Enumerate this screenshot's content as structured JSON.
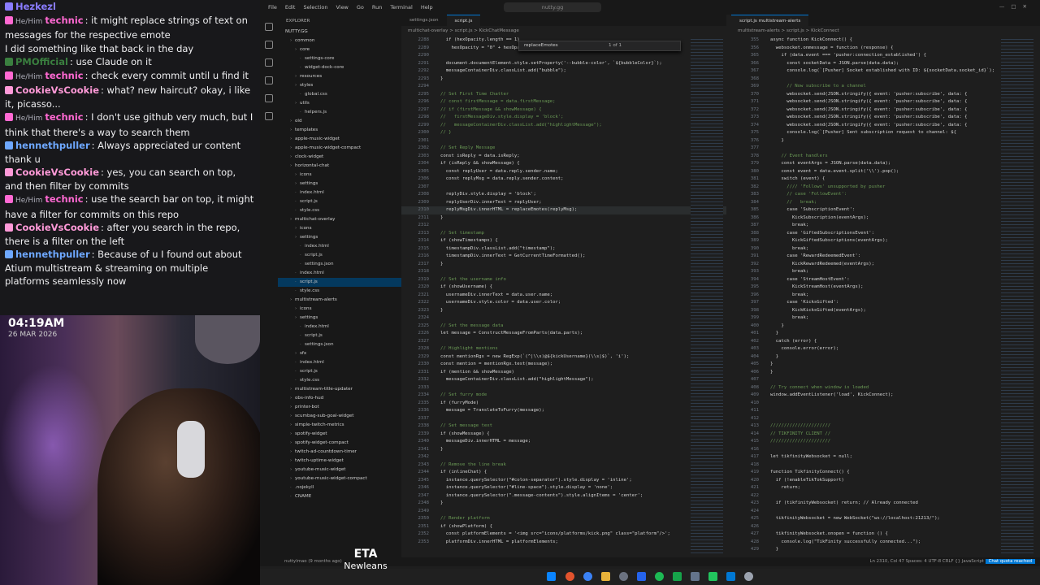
{
  "chat": {
    "messages": [
      {
        "user": "Hezkezl",
        "pronoun": "",
        "text": "",
        "color": "#8a7cff"
      },
      {
        "user": "technic",
        "pronoun": "He/Him",
        "text": ": it might replace strings of text on messages for the respective emote",
        "color": "#ff69d2"
      },
      {
        "user": "",
        "pronoun": "",
        "text": "I did something like that back in the day",
        "color": "#efeff1"
      },
      {
        "user": "PMOfficial",
        "pronoun": "",
        "text": ": use Claude on it",
        "color": "#3a7f3f"
      },
      {
        "user": "technic",
        "pronoun": "He/Him",
        "text": ": check every commit until u find it",
        "color": "#ff69d2"
      },
      {
        "user": "CookieVsCookie",
        "pronoun": "",
        "text": ": what? new haircut? okay, i like it, picasso...",
        "color": "#ff9ad8"
      },
      {
        "user": "technic",
        "pronoun": "He/Him",
        "text": ": I don't use github very much, but I think that there's a way to search them",
        "color": "#ff69d2"
      },
      {
        "user": "hennethpuller",
        "pronoun": "",
        "text": ": Always appreciated ur content thank u",
        "color": "#6ea8ff"
      },
      {
        "user": "CookieVsCookie",
        "pronoun": "",
        "text": ": yes, you can search on top, and then filter by commits",
        "color": "#ff9ad8"
      },
      {
        "user": "technic",
        "pronoun": "He/Him",
        "text": ": use the search bar on top, it might have a filter for commits on this repo",
        "color": "#ff69d2"
      },
      {
        "user": "CookieVsCookie",
        "pronoun": "",
        "text": ": after you search in the repo, there is a filter on the left",
        "color": "#ff9ad8"
      },
      {
        "user": "hennethpuller",
        "pronoun": "",
        "text": ": Because of u I found out about Atium multistream & streaming on multiple platforms seamlessly now",
        "color": "#6ea8ff"
      }
    ],
    "time": "04:19AM",
    "date": "26 MAR 2026"
  },
  "now_playing": {
    "song": "ETA",
    "artist": "NewJeans"
  },
  "vscode": {
    "menu": [
      "File",
      "Edit",
      "Selection",
      "View",
      "Go",
      "Run",
      "Terminal",
      "Help"
    ],
    "search": "nutty.gg",
    "explorer_title": "EXPLORER",
    "root": "NUTTY.GG",
    "tree": [
      {
        "name": "common",
        "depth": 1,
        "folder": true
      },
      {
        "name": "core",
        "depth": 2,
        "folder": true
      },
      {
        "name": "settings-core",
        "depth": 3,
        "folder": false
      },
      {
        "name": "widget-dock-core",
        "depth": 3,
        "folder": false
      },
      {
        "name": "resources",
        "depth": 2,
        "folder": true
      },
      {
        "name": "styles",
        "depth": 2,
        "folder": true
      },
      {
        "name": "global.css",
        "depth": 3,
        "folder": false
      },
      {
        "name": "utils",
        "depth": 2,
        "folder": true
      },
      {
        "name": "helpers.js",
        "depth": 3,
        "folder": false
      },
      {
        "name": "old",
        "depth": 1,
        "folder": true
      },
      {
        "name": "templates",
        "depth": 1,
        "folder": true
      },
      {
        "name": "apple-music-widget",
        "depth": 1,
        "folder": true
      },
      {
        "name": "apple-music-widget-compact",
        "depth": 1,
        "folder": true
      },
      {
        "name": "clock-widget",
        "depth": 1,
        "folder": true
      },
      {
        "name": "horizontal-chat",
        "depth": 1,
        "folder": true
      },
      {
        "name": "icons",
        "depth": 2,
        "folder": true
      },
      {
        "name": "settings",
        "depth": 2,
        "folder": true
      },
      {
        "name": "index.html",
        "depth": 2,
        "folder": false
      },
      {
        "name": "script.js",
        "depth": 2,
        "folder": false
      },
      {
        "name": "style.css",
        "depth": 2,
        "folder": false
      },
      {
        "name": "multichat-overlay",
        "depth": 1,
        "folder": true
      },
      {
        "name": "icons",
        "depth": 2,
        "folder": true
      },
      {
        "name": "settings",
        "depth": 2,
        "folder": true
      },
      {
        "name": "index.html",
        "depth": 3,
        "folder": false
      },
      {
        "name": "script.js",
        "depth": 3,
        "folder": false
      },
      {
        "name": "settings.json",
        "depth": 3,
        "folder": false
      },
      {
        "name": "index.html",
        "depth": 2,
        "folder": false
      },
      {
        "name": "script.js",
        "depth": 2,
        "folder": false,
        "selected": true
      },
      {
        "name": "style.css",
        "depth": 2,
        "folder": false
      },
      {
        "name": "multistream-alerts",
        "depth": 1,
        "folder": true
      },
      {
        "name": "icons",
        "depth": 2,
        "folder": true
      },
      {
        "name": "settings",
        "depth": 2,
        "folder": true
      },
      {
        "name": "index.html",
        "depth": 3,
        "folder": false
      },
      {
        "name": "script.js",
        "depth": 3,
        "folder": false
      },
      {
        "name": "settings.json",
        "depth": 3,
        "folder": false
      },
      {
        "name": "sfx",
        "depth": 2,
        "folder": true
      },
      {
        "name": "index.html",
        "depth": 2,
        "folder": false
      },
      {
        "name": "script.js",
        "depth": 2,
        "folder": false
      },
      {
        "name": "style.css",
        "depth": 2,
        "folder": false
      },
      {
        "name": "multistream-title-updater",
        "depth": 1,
        "folder": true
      },
      {
        "name": "obs-info-hud",
        "depth": 1,
        "folder": true
      },
      {
        "name": "printer-bot",
        "depth": 1,
        "folder": true
      },
      {
        "name": "scumbag-sub-goal-widget",
        "depth": 1,
        "folder": true
      },
      {
        "name": "simple-twitch-metrics",
        "depth": 1,
        "folder": true
      },
      {
        "name": "spotify-widget",
        "depth": 1,
        "folder": true
      },
      {
        "name": "spotify-widget-compact",
        "depth": 1,
        "folder": true
      },
      {
        "name": "twitch-ad-countdown-timer",
        "depth": 1,
        "folder": true
      },
      {
        "name": "twitch-uptime-widget",
        "depth": 1,
        "folder": true
      },
      {
        "name": "youtube-music-widget",
        "depth": 1,
        "folder": true
      },
      {
        "name": "youtube-music-widget-compact",
        "depth": 1,
        "folder": true
      },
      {
        "name": ".nojekyll",
        "depth": 1,
        "folder": false
      },
      {
        "name": "CNAME",
        "depth": 1,
        "folder": false
      }
    ],
    "left_tabs": [
      "settings.json",
      "script.js"
    ],
    "left_breadcrumb": "multichat-overlay  >  script.js  >  KickChatMessage",
    "find_query": "replaceEmotes",
    "find_count": "1 of 1",
    "left_code": [
      {
        "n": "2288",
        "t": "  if (hexOpacity.length == 1)"
      },
      {
        "n": "2289",
        "t": "    hexOpacity = \"0\" + hexOpacity;"
      },
      {
        "n": "2290",
        "t": ""
      },
      {
        "n": "2291",
        "t": "  document.documentElement.style.setProperty('--bubble-color', `${bubbleColor}`);"
      },
      {
        "n": "2292",
        "t": "  messageContainerDiv.classList.add(\"bubble\");"
      },
      {
        "n": "2293",
        "t": "}"
      },
      {
        "n": "2294",
        "t": ""
      },
      {
        "n": "2295",
        "t": "// Set First Time Chatter"
      },
      {
        "n": "2296",
        "t": "// const firstMessage = data.firstMessage;"
      },
      {
        "n": "2297",
        "t": "// if (firstMessage && showMessage) {"
      },
      {
        "n": "2298",
        "t": "//   firstMessageDiv.style.display = 'block';"
      },
      {
        "n": "2299",
        "t": "//   messageContainerDiv.classList.add(\"highlightMessage\");"
      },
      {
        "n": "2300",
        "t": "// }"
      },
      {
        "n": "2301",
        "t": ""
      },
      {
        "n": "2302",
        "t": "// Set Reply Message"
      },
      {
        "n": "2303",
        "t": "const isReply = data.isReply;"
      },
      {
        "n": "2304",
        "t": "if (isReply && showMessage) {"
      },
      {
        "n": "2305",
        "t": "  const replyUser = data.reply.sender.name;"
      },
      {
        "n": "2306",
        "t": "  const replyMsg = data.reply.sender.content;"
      },
      {
        "n": "2307",
        "t": ""
      },
      {
        "n": "2308",
        "t": "  replyDiv.style.display = 'block';"
      },
      {
        "n": "2309",
        "t": "  replyUserDiv.innerText = replyUser;"
      },
      {
        "n": "2310",
        "t": "  replyMsgDiv.innerHTML = replaceEmotes(replyMsg);"
      },
      {
        "n": "2311",
        "t": "}"
      },
      {
        "n": "2312",
        "t": ""
      },
      {
        "n": "2313",
        "t": "// Set timestamp"
      },
      {
        "n": "2314",
        "t": "if (showTimestamps) {"
      },
      {
        "n": "2315",
        "t": "  timestampDiv.classList.add(\"timestamp\");"
      },
      {
        "n": "2316",
        "t": "  timestampDiv.innerText = GetCurrentTimeFormatted();"
      },
      {
        "n": "2317",
        "t": "}"
      },
      {
        "n": "2318",
        "t": ""
      },
      {
        "n": "2319",
        "t": "// Set the username info"
      },
      {
        "n": "2320",
        "t": "if (showUsername) {"
      },
      {
        "n": "2321",
        "t": "  usernameDiv.innerText = data.user.name;"
      },
      {
        "n": "2322",
        "t": "  usernameDiv.style.color = data.user.color;"
      },
      {
        "n": "2323",
        "t": "}"
      },
      {
        "n": "2324",
        "t": ""
      },
      {
        "n": "2325",
        "t": "// Set the message data"
      },
      {
        "n": "2326",
        "t": "let message = ConstructMessageFromParts(data.parts);"
      },
      {
        "n": "2327",
        "t": ""
      },
      {
        "n": "2328",
        "t": "// Highlight mentions"
      },
      {
        "n": "2329",
        "t": "const mentionRgx = new RegExp(`(^|\\\\s)@${kickUsername}(\\\\s|$)`, 'i');"
      },
      {
        "n": "2330",
        "t": "const mention = mentionRgx.test(message);"
      },
      {
        "n": "2331",
        "t": "if (mention && showMessage)"
      },
      {
        "n": "2332",
        "t": "  messageContainerDiv.classList.add(\"highlightMessage\");"
      },
      {
        "n": "2333",
        "t": ""
      },
      {
        "n": "2334",
        "t": "// Set furry mode"
      },
      {
        "n": "2335",
        "t": "if (furryMode)"
      },
      {
        "n": "2336",
        "t": "  message = TranslateToFurry(message);"
      },
      {
        "n": "2337",
        "t": ""
      },
      {
        "n": "2338",
        "t": "// Set message text"
      },
      {
        "n": "2339",
        "t": "if (showMessage) {"
      },
      {
        "n": "2340",
        "t": "  messageDiv.innerHTML = message;"
      },
      {
        "n": "2341",
        "t": "}"
      },
      {
        "n": "2342",
        "t": ""
      },
      {
        "n": "2343",
        "t": "// Remove the line break"
      },
      {
        "n": "2344",
        "t": "if (inlineChat) {"
      },
      {
        "n": "2345",
        "t": "  instance.querySelector(\"#colon-separator\").style.display = 'inline';"
      },
      {
        "n": "2346",
        "t": "  instance.querySelector(\"#line-space\").style.display = 'none';"
      },
      {
        "n": "2347",
        "t": "  instance.querySelector(\".message-contents\").style.alignItems = 'center';"
      },
      {
        "n": "2348",
        "t": "}"
      },
      {
        "n": "2349",
        "t": ""
      },
      {
        "n": "2350",
        "t": "// Render platform"
      },
      {
        "n": "2351",
        "t": "if (showPlatform) {"
      },
      {
        "n": "2352",
        "t": "  const platformElements = '<img src=\"icons/platforms/kick.png\" class=\"platform\"/>';"
      },
      {
        "n": "2353",
        "t": "  platformDiv.innerHTML = platformElements;"
      }
    ],
    "right_tabs": [
      "script.js multistream-alerts"
    ],
    "right_breadcrumb": "multistream-alerts  >  script.js  >  KickConnect",
    "right_code": [
      {
        "n": "355",
        "t": "async function KickConnect() {"
      },
      {
        "n": "356",
        "t": "  websocket.onmessage = function (response) {"
      },
      {
        "n": "365",
        "t": "    if (data.event === 'pusher:connection_established') {"
      },
      {
        "n": "366",
        "t": "      const socketData = JSON.parse(data.data);"
      },
      {
        "n": "367",
        "t": "      console.log(`[Pusher] Socket established with ID: ${socketData.socket_id}`);"
      },
      {
        "n": "368",
        "t": ""
      },
      {
        "n": "369",
        "t": "      // Now subscribe to a channel"
      },
      {
        "n": "370",
        "t": "      websocket.send(JSON.stringify({ event: 'pusher:subscribe', data: {"
      },
      {
        "n": "371",
        "t": "      websocket.send(JSON.stringify({ event: 'pusher:subscribe', data: {"
      },
      {
        "n": "372",
        "t": "      websocket.send(JSON.stringify({ event: 'pusher:subscribe', data: {"
      },
      {
        "n": "373",
        "t": "      websocket.send(JSON.stringify({ event: 'pusher:subscribe', data: {"
      },
      {
        "n": "374",
        "t": "      websocket.send(JSON.stringify({ event: 'pusher:subscribe', data: {"
      },
      {
        "n": "375",
        "t": "      console.log(`[Pusher] Sent subscription request to channel: ${"
      },
      {
        "n": "376",
        "t": "    }"
      },
      {
        "n": "377",
        "t": ""
      },
      {
        "n": "378",
        "t": "    // Event handlers"
      },
      {
        "n": "379",
        "t": "    const eventArgs = JSON.parse(data.data);"
      },
      {
        "n": "380",
        "t": "    const event = data.event.split('\\\\').pop();"
      },
      {
        "n": "381",
        "t": "    switch (event) {"
      },
      {
        "n": "382",
        "t": "      //// 'Follows' unsupported by pusher"
      },
      {
        "n": "383",
        "t": "      // case 'FollowEvent':"
      },
      {
        "n": "384",
        "t": "      //   break;"
      },
      {
        "n": "385",
        "t": "      case 'SubscriptionEvent':"
      },
      {
        "n": "386",
        "t": "        KickSubscription(eventArgs);"
      },
      {
        "n": "387",
        "t": "        break;"
      },
      {
        "n": "388",
        "t": "      case 'GiftedSubscriptionsEvent':"
      },
      {
        "n": "389",
        "t": "        KickGiftedSubscriptions(eventArgs);"
      },
      {
        "n": "390",
        "t": "        break;"
      },
      {
        "n": "391",
        "t": "      case 'RewardRedeemedEvent':"
      },
      {
        "n": "392",
        "t": "        KickRewardRedeemed(eventArgs);"
      },
      {
        "n": "393",
        "t": "        break;"
      },
      {
        "n": "394",
        "t": "      case 'StreamHostEvent':"
      },
      {
        "n": "395",
        "t": "        KickStreamHost(eventArgs);"
      },
      {
        "n": "396",
        "t": "        break;"
      },
      {
        "n": "397",
        "t": "      case 'KicksGifted':"
      },
      {
        "n": "398",
        "t": "        KickKicksGifted(eventArgs);"
      },
      {
        "n": "399",
        "t": "        break;"
      },
      {
        "n": "400",
        "t": "    }"
      },
      {
        "n": "401",
        "t": "  }"
      },
      {
        "n": "402",
        "t": "  catch (error) {"
      },
      {
        "n": "403",
        "t": "    console.error(error);"
      },
      {
        "n": "404",
        "t": "  }"
      },
      {
        "n": "405",
        "t": "}"
      },
      {
        "n": "406",
        "t": "}"
      },
      {
        "n": "407",
        "t": ""
      },
      {
        "n": "408",
        "t": "// Try connect when window is loaded"
      },
      {
        "n": "409",
        "t": "window.addEventListener('load', KickConnect);"
      },
      {
        "n": "410",
        "t": ""
      },
      {
        "n": "411",
        "t": ""
      },
      {
        "n": "412",
        "t": ""
      },
      {
        "n": "413",
        "t": "//////////////////////"
      },
      {
        "n": "414",
        "t": "// TIKFINITY CLIENT //"
      },
      {
        "n": "415",
        "t": "//////////////////////"
      },
      {
        "n": "416",
        "t": ""
      },
      {
        "n": "417",
        "t": "let tikfinityWebsocket = null;"
      },
      {
        "n": "418",
        "t": ""
      },
      {
        "n": "419",
        "t": "function TikfinityConnect() {"
      },
      {
        "n": "420",
        "t": "  if (!enableTikTokSupport)"
      },
      {
        "n": "421",
        "t": "    return;"
      },
      {
        "n": "422",
        "t": ""
      },
      {
        "n": "423",
        "t": "  if (tikfinityWebsocket) return; // Already connected"
      },
      {
        "n": "424",
        "t": ""
      },
      {
        "n": "425",
        "t": "  tikfinityWebsocket = new WebSocket(\"ws://localhost:21213/\");"
      },
      {
        "n": "426",
        "t": ""
      },
      {
        "n": "427",
        "t": "  tikfinityWebsocket.onopen = function () {"
      },
      {
        "n": "428",
        "t": "    console.log(\"TikFinity successfully connected...\");"
      },
      {
        "n": "429",
        "t": "  }"
      }
    ],
    "status_left": "nuttylmao (9 months ago)",
    "status_right": "Ln 2310, Col 47   Spaces: 4   UTF-8   CRLF   {} JavaScript",
    "status_badge": "Chat quota reached"
  }
}
